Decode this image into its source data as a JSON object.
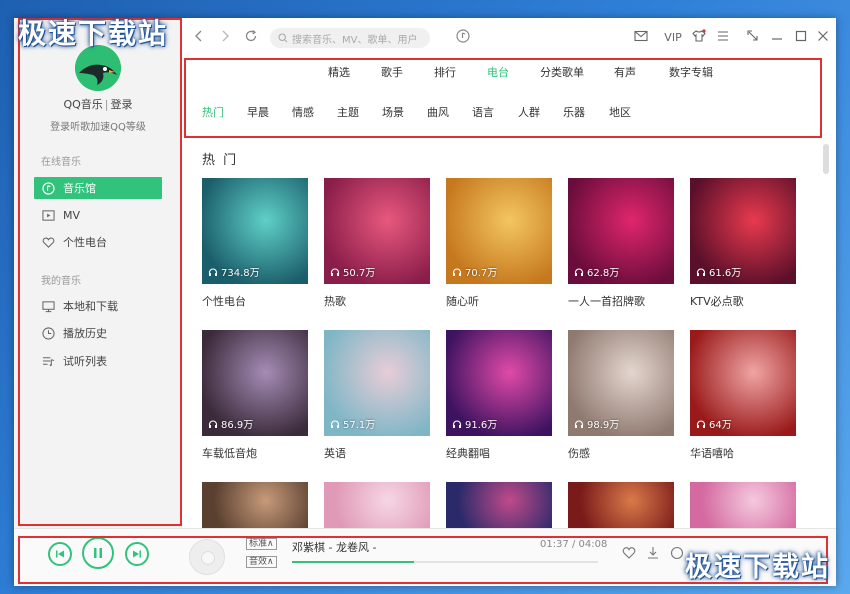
{
  "watermark": "极速下载站",
  "user": {
    "name": "QQ音乐",
    "sep": "|",
    "login": "登录",
    "tip": "登录听歌加速QQ等级"
  },
  "sidebar": {
    "section_online": "在线音乐",
    "section_mine": "我的音乐",
    "online_items": [
      {
        "label": "音乐馆",
        "icon": "music-hall-icon"
      },
      {
        "label": "MV",
        "icon": "mv-icon"
      },
      {
        "label": "个性电台",
        "icon": "radio-heart-icon"
      }
    ],
    "mine_items": [
      {
        "label": "本地和下载",
        "icon": "monitor-icon"
      },
      {
        "label": "播放历史",
        "icon": "clock-icon"
      },
      {
        "label": "试听列表",
        "icon": "playlist-icon"
      }
    ]
  },
  "topbar": {
    "search_placeholder": "搜索音乐、MV、歌单、用户",
    "vip_label": "VIP"
  },
  "category_tabs": [
    "精选",
    "歌手",
    "排行",
    "电台",
    "分类歌单",
    "有声",
    "数字专辑"
  ],
  "category_active": "电台",
  "sub_tabs": [
    "热门",
    "早晨",
    "情感",
    "主题",
    "场景",
    "曲风",
    "语言",
    "人群",
    "乐器",
    "地区"
  ],
  "sub_active": "热门",
  "content_title": "热 门",
  "cards": [
    {
      "name": "个性电台",
      "plays": "734.8万",
      "colors": [
        "#1b5e6b",
        "#5fd0c7"
      ]
    },
    {
      "name": "热歌",
      "plays": "50.7万",
      "colors": [
        "#8a1e4a",
        "#e8587e"
      ]
    },
    {
      "name": "随心听",
      "plays": "70.7万",
      "colors": [
        "#c6781e",
        "#f3c661"
      ]
    },
    {
      "name": "一人一首招牌歌",
      "plays": "62.8万",
      "colors": [
        "#6b0d3c",
        "#e0266c"
      ]
    },
    {
      "name": "KTV必点歌",
      "plays": "61.6万",
      "colors": [
        "#5a0f2a",
        "#e83a4e"
      ]
    },
    {
      "name": "车载低音炮",
      "plays": "86.9万",
      "colors": [
        "#3a2a3a",
        "#a58cb5"
      ]
    },
    {
      "name": "英语",
      "plays": "57.1万",
      "colors": [
        "#7fb6c6",
        "#e7cdd7"
      ]
    },
    {
      "name": "经典翻唱",
      "plays": "91.6万",
      "colors": [
        "#3d1360",
        "#e04aa8"
      ]
    },
    {
      "name": "伤感",
      "plays": "98.9万",
      "colors": [
        "#8f7a70",
        "#e4d6cf"
      ]
    },
    {
      "name": "华语嘻哈",
      "plays": "64万",
      "colors": [
        "#9a1a1a",
        "#f0a4a4"
      ]
    },
    {
      "name": "",
      "plays": "",
      "colors": [
        "#5a4030",
        "#c79a7a"
      ]
    },
    {
      "name": "",
      "plays": "",
      "colors": [
        "#e09ab8",
        "#f6d7e4"
      ]
    },
    {
      "name": "",
      "plays": "",
      "colors": [
        "#2a2a6a",
        "#c04a8a"
      ]
    },
    {
      "name": "",
      "plays": "",
      "colors": [
        "#7a1a1a",
        "#d97a4a"
      ]
    },
    {
      "name": "",
      "plays": "",
      "colors": [
        "#d46aa0",
        "#f5c9de"
      ]
    }
  ],
  "player": {
    "quality_tag": "标准",
    "effect_tag": "音效",
    "song": "邓紫棋 - 龙卷风 -",
    "time": "01:37 / 04:08",
    "progress": 0.4
  },
  "colors": {
    "accent": "#31c27c",
    "highlight_box": "#e03030"
  }
}
